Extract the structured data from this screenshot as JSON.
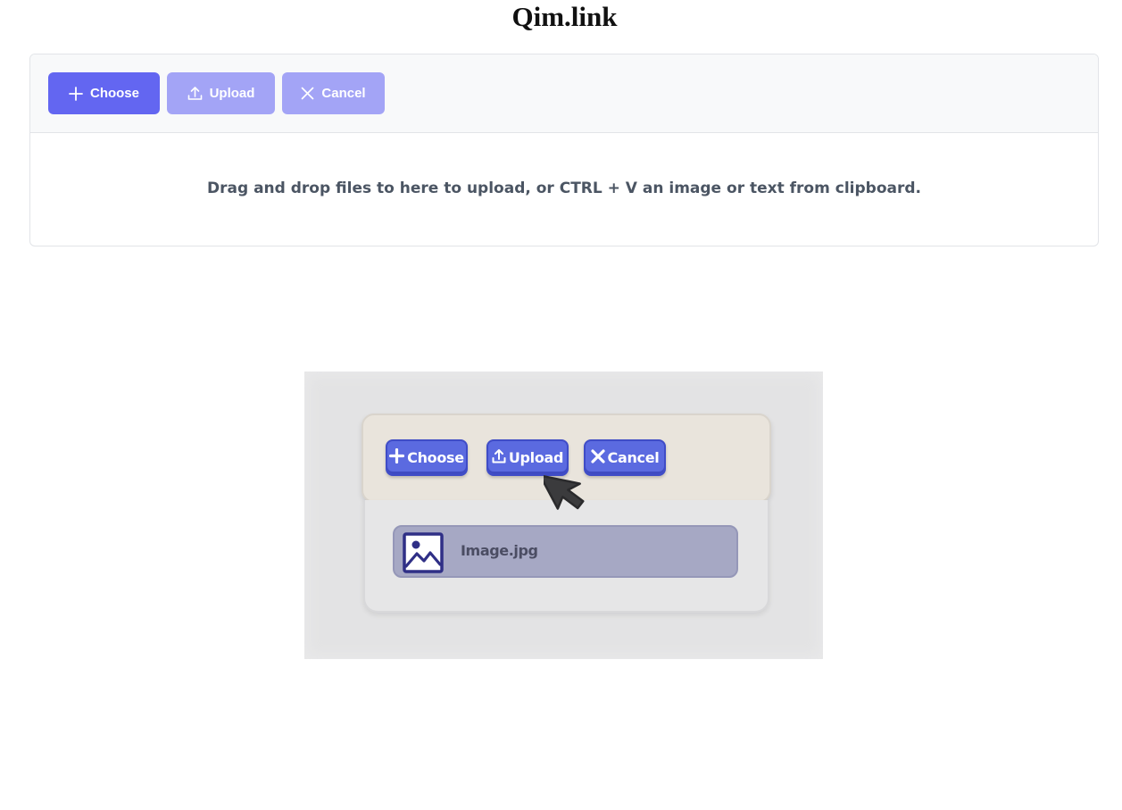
{
  "site": {
    "title": "Qim.link"
  },
  "uploader": {
    "toolbar": {
      "choose_label": "Choose",
      "upload_label": "Upload",
      "cancel_label": "Cancel"
    },
    "drop_hint": "Drag and drop files to here to upload, or CTRL + V an image or text from clipboard.",
    "colors": {
      "primary": "#6366f1",
      "primary_disabled": "#a3a4f6",
      "toolbar_bg": "#f8f9fa",
      "hint_text": "#4b5563"
    },
    "icons": {
      "choose": "plus-icon",
      "upload": "upload-icon",
      "cancel": "close-icon"
    }
  },
  "illustration": {
    "buttons": {
      "choose_label": "Choose",
      "upload_label": "Upload",
      "cancel_label": "Cancel"
    },
    "file": {
      "name": "Image.jpg",
      "icon": "image-file-icon"
    },
    "cursor_icon": "mouse-pointer-icon"
  }
}
